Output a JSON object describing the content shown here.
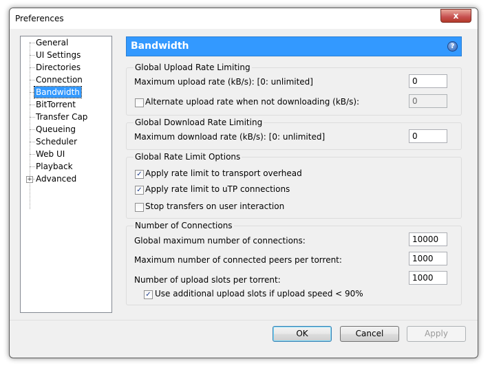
{
  "window": {
    "title": "Preferences",
    "close_glyph": "x"
  },
  "tree": {
    "items": [
      {
        "label": "General"
      },
      {
        "label": "UI Settings"
      },
      {
        "label": "Directories"
      },
      {
        "label": "Connection"
      },
      {
        "label": "Bandwidth"
      },
      {
        "label": "BitTorrent"
      },
      {
        "label": "Transfer Cap"
      },
      {
        "label": "Queueing"
      },
      {
        "label": "Scheduler"
      },
      {
        "label": "Web UI"
      },
      {
        "label": "Playback"
      },
      {
        "label": "Advanced"
      }
    ],
    "selected": "Bandwidth",
    "expander_glyph": "+"
  },
  "header": {
    "title": "Bandwidth",
    "help_glyph": "?"
  },
  "upload": {
    "group_title": "Global Upload Rate Limiting",
    "max_label": "Maximum upload rate (kB/s): [0: unlimited]",
    "max_value": "0",
    "alt_label": "Alternate upload rate when not downloading (kB/s):",
    "alt_checked": false,
    "alt_value": "0"
  },
  "download": {
    "group_title": "Global Download Rate Limiting",
    "max_label": "Maximum download rate (kB/s): [0: unlimited]",
    "max_value": "0"
  },
  "options": {
    "group_title": "Global Rate Limit Options",
    "items": [
      {
        "label": "Apply rate limit to transport overhead",
        "checked": true
      },
      {
        "label": "Apply rate limit to uTP connections",
        "checked": true
      },
      {
        "label": "Stop transfers on user interaction",
        "checked": false
      }
    ]
  },
  "connections": {
    "group_title": "Number of Connections",
    "global_label": "Global maximum number of connections:",
    "global_value": "10000",
    "peers_label": "Maximum number of connected peers per torrent:",
    "peers_value": "1000",
    "slots_label": "Number of upload slots per torrent:",
    "slots_value": "1000",
    "extra_label": "Use additional upload slots if upload speed < 90%",
    "extra_checked": true
  },
  "buttons": {
    "ok": "OK",
    "cancel": "Cancel",
    "apply": "Apply"
  },
  "check_glyph": "✓",
  "colors": {
    "header_bg": "#3399ff",
    "selection_bg": "#3399ff",
    "close_button": "#c75050"
  }
}
